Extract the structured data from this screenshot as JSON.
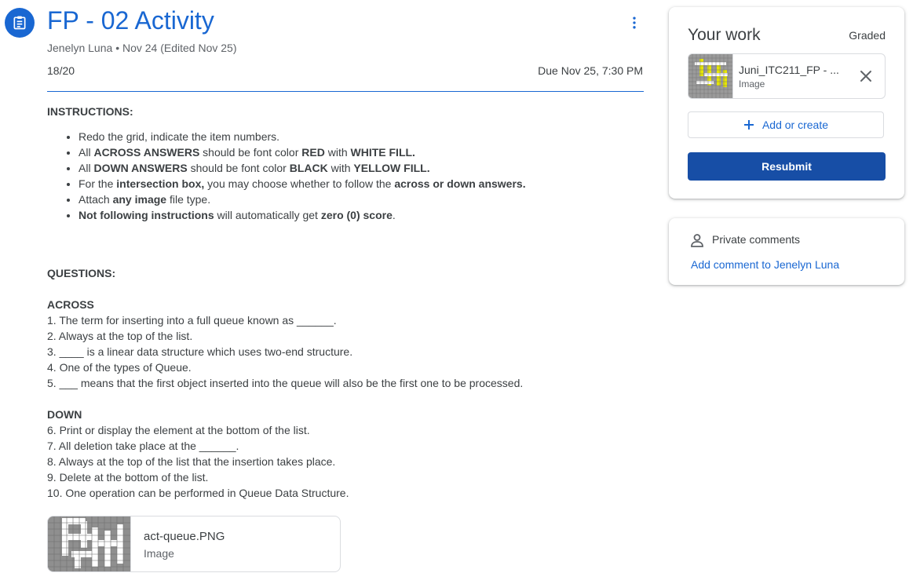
{
  "header": {
    "icon": "assignment-icon",
    "title": "FP - 02 Activity",
    "more_icon": "more-vert-icon",
    "author": "Jenelyn Luna",
    "separator": "•",
    "date": "Nov 24 (Edited Nov 25)",
    "points": "18/20",
    "due": "Due Nov 25, 7:30 PM",
    "accent_color": "#1967d2"
  },
  "instructions": {
    "heading": "INSTRUCTIONS:",
    "items": [
      {
        "parts": [
          {
            "t": "Redo the grid, indicate the item numbers.",
            "b": false
          }
        ]
      },
      {
        "parts": [
          {
            "t": "All ",
            "b": false
          },
          {
            "t": "ACROSS ANSWERS",
            "b": true
          },
          {
            "t": " should be font color ",
            "b": false
          },
          {
            "t": "RED",
            "b": true
          },
          {
            "t": " with ",
            "b": false
          },
          {
            "t": "WHITE FILL.",
            "b": true
          }
        ]
      },
      {
        "parts": [
          {
            "t": "All ",
            "b": false
          },
          {
            "t": "DOWN ANSWERS",
            "b": true
          },
          {
            "t": " should be font color ",
            "b": false
          },
          {
            "t": "BLACK",
            "b": true
          },
          {
            "t": " with ",
            "b": false
          },
          {
            "t": "YELLOW FILL.",
            "b": true
          }
        ]
      },
      {
        "parts": [
          {
            "t": "For the ",
            "b": false
          },
          {
            "t": "intersection box,",
            "b": true
          },
          {
            "t": " you may choose whether to follow the ",
            "b": false
          },
          {
            "t": "across or down answers.",
            "b": true
          }
        ]
      },
      {
        "parts": [
          {
            "t": "Attach ",
            "b": false
          },
          {
            "t": "any image",
            "b": true
          },
          {
            "t": " file type.",
            "b": false
          }
        ]
      },
      {
        "parts": [
          {
            "t": "Not following instructions",
            "b": true
          },
          {
            "t": " will automatically get ",
            "b": false
          },
          {
            "t": "zero (0) score",
            "b": true
          },
          {
            "t": ".",
            "b": false
          }
        ]
      }
    ]
  },
  "questions": {
    "heading": "QUESTIONS:",
    "across_heading": "ACROSS",
    "across": [
      "1. The term for inserting into a full queue known as ______.",
      "2. Always at the top of the list.",
      "3. ____ is a linear data structure which uses two-end structure.",
      "4. One of the types of Queue.",
      "5. ___ means that the first object inserted into the queue will also be the first one to be processed."
    ],
    "down_heading": "DOWN",
    "down": [
      "6. Print or display the element at the bottom of the list.",
      "7. All deletion take place at the ______.",
      "8. Always at the top of the list that the insertion takes place.",
      "9. Delete at the bottom of the list.",
      "10. One operation can be performed in Queue Data Structure."
    ]
  },
  "attachment": {
    "name": "act-queue.PNG",
    "type": "Image"
  },
  "your_work": {
    "title": "Your work",
    "status": "Graded",
    "file": {
      "name": "Juni_ITC211_FP - ...",
      "type": "Image",
      "remove_icon": "close-icon"
    },
    "add_label": "Add or create",
    "add_icon": "plus-icon",
    "resubmit_label": "Resubmit",
    "button_color": "#174ea6"
  },
  "private_comments": {
    "icon": "person-icon",
    "title": "Private comments",
    "link": "Add comment to Jenelyn Luna"
  }
}
